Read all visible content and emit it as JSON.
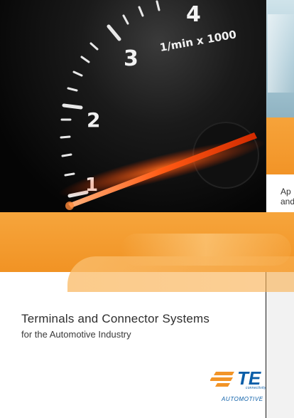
{
  "back_brochure": {
    "text_line1": "Ap",
    "text_line2": "and"
  },
  "gauge": {
    "tick_labels": [
      "1",
      "2",
      "3",
      "4"
    ],
    "unit": "1/min x 1000"
  },
  "cover": {
    "title": "Terminals and Connector Systems",
    "subtitle": "for the Automotive Industry"
  },
  "logo": {
    "mark": "TE",
    "connectivity": "connectivity",
    "division": "AUTOMOTIVE"
  },
  "colors": {
    "orange": "#f29427",
    "te_blue": "#0a5ea8"
  }
}
